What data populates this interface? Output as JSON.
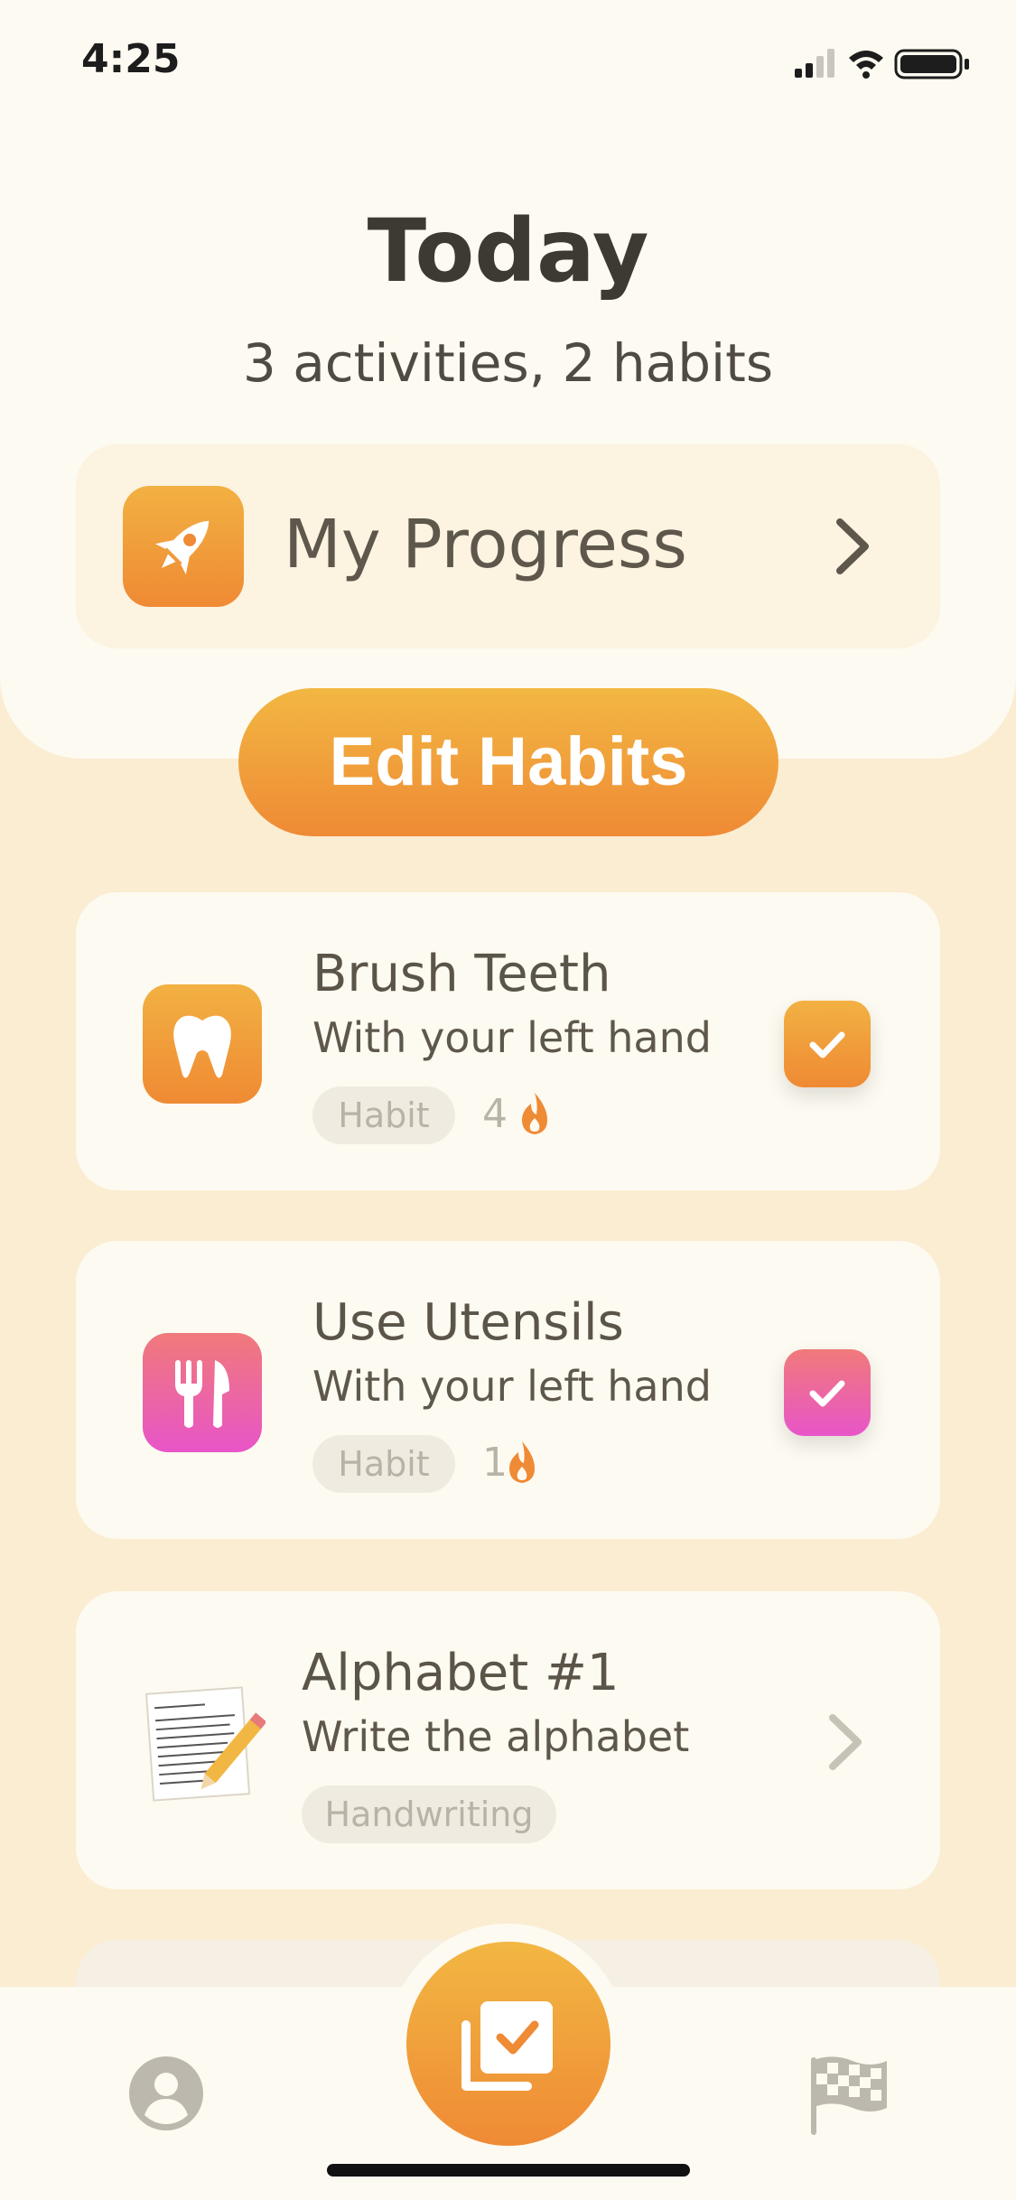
{
  "status_bar": {
    "time": "4:25"
  },
  "header": {
    "title": "Today",
    "subtitle": "3 activities, 2 habits",
    "progress_label": "My Progress"
  },
  "edit_button": {
    "label": "Edit Habits"
  },
  "colors": {
    "accent_orange": "#ef8a35",
    "accent_pink": "#e855c8",
    "background": "#fbedd2"
  },
  "activities": [
    {
      "title": "Brush Teeth",
      "subtitle": "With your left hand",
      "tag": "Habit",
      "streak": "4",
      "icon": "tooth-icon",
      "checked": true
    },
    {
      "title": "Use Utensils",
      "subtitle": "With your left hand",
      "tag": "Habit",
      "streak": "1",
      "icon": "fork-knife-icon",
      "checked": true
    },
    {
      "title": "Alphabet #1",
      "subtitle": "Write the alphabet",
      "tag": "Handwriting",
      "icon": "handwriting-note-icon"
    }
  ],
  "tabbar": {
    "left_icon": "profile-icon",
    "center_icon": "activities-check-icon",
    "right_icon": "checkered-flag-icon"
  }
}
